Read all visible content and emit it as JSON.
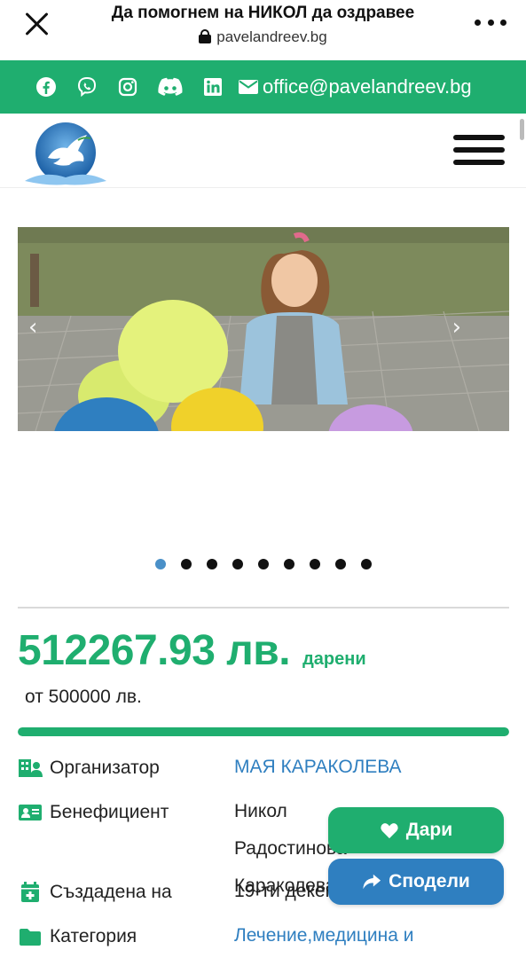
{
  "browser": {
    "title": "Да помогнем на НИКОЛ да оздравее",
    "url": "pavelandreev.bg"
  },
  "social": {
    "icons": [
      "facebook-icon",
      "viber-icon",
      "instagram-icon",
      "discord-icon",
      "linkedin-icon"
    ],
    "email": "office@pavelandreev.bg"
  },
  "slider": {
    "prev_label": "‹",
    "next_label": "›",
    "slide_count": 9,
    "active_slide": 1
  },
  "campaign": {
    "amount": "512267.93 лв.",
    "donated_label": "дарени",
    "goal": "от 500000 лв.",
    "progress": 1.0
  },
  "details": [
    {
      "label": "Организатор",
      "value": "МАЯ КАРАКОЛЕВА",
      "link": true,
      "icon": "building-user-icon"
    },
    {
      "label": "Бенефициент",
      "value": "Никол Радостинова Караколева",
      "link": false,
      "icon": "id-card-icon"
    },
    {
      "label": "Създадена на",
      "value": "19-ти декември",
      "link": false,
      "icon": "calendar-plus-icon"
    },
    {
      "label": "Категория",
      "value": "Лечение,медицина и",
      "link": true,
      "icon": "folder-icon"
    }
  ],
  "actions": {
    "donate_label": "Дари",
    "share_label": "Сподели"
  },
  "colors": {
    "brand_green": "#1fae6f",
    "link_blue": "#2f7fc0"
  }
}
